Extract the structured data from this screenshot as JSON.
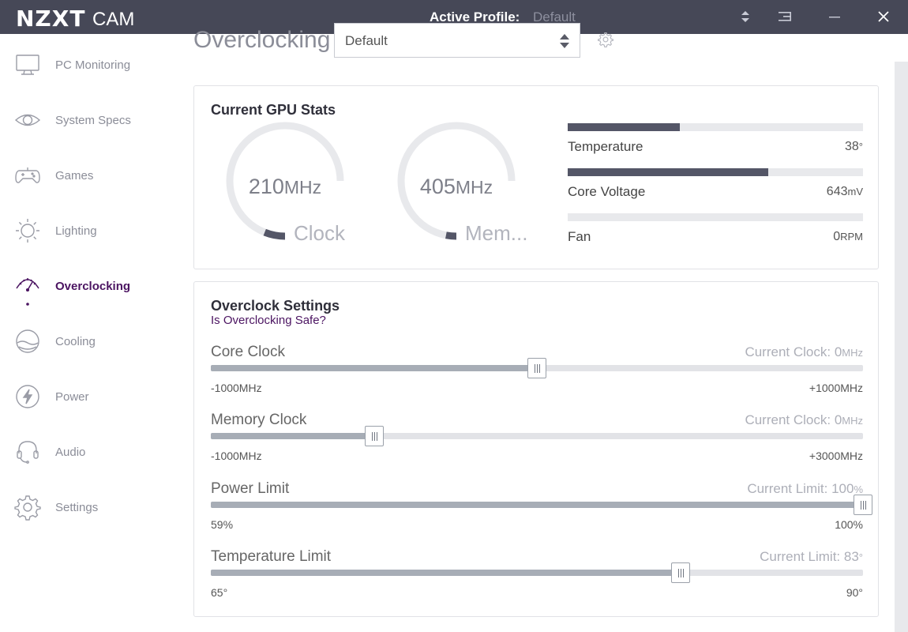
{
  "titlebar": {
    "logo": "NZXT",
    "logo_sub": "CAM",
    "active_profile_label": "Active Profile:",
    "active_profile_value": "Default"
  },
  "sidebar": {
    "items": [
      {
        "label": "PC Monitoring",
        "icon": "monitor-icon"
      },
      {
        "label": "System Specs",
        "icon": "eye-icon"
      },
      {
        "label": "Games",
        "icon": "gamepad-icon"
      },
      {
        "label": "Lighting",
        "icon": "sun-icon"
      },
      {
        "label": "Overclocking",
        "icon": "speedometer-icon",
        "active": true
      },
      {
        "label": "Cooling",
        "icon": "cooling-icon"
      },
      {
        "label": "Power",
        "icon": "lightning-icon"
      },
      {
        "label": "Audio",
        "icon": "headset-icon"
      },
      {
        "label": "Settings",
        "icon": "gear-icon"
      }
    ]
  },
  "header": {
    "title": "Overclocking",
    "profile_select_value": "Default"
  },
  "gpu_stats": {
    "title": "Current GPU Stats",
    "gauges": [
      {
        "value": "210",
        "unit": "MHz",
        "label": "Clock",
        "fraction": 0.08
      },
      {
        "value": "405",
        "unit": "MHz",
        "label": "Mem...",
        "fraction": 0.04
      }
    ],
    "bars": [
      {
        "name": "Temperature",
        "value": "38",
        "unit": "°",
        "fraction": 0.38
      },
      {
        "name": "Core Voltage",
        "value": "643",
        "unit": "mV",
        "fraction": 0.68
      },
      {
        "name": "Fan",
        "value": "0",
        "unit": "RPM",
        "fraction": 0
      }
    ]
  },
  "overclock": {
    "title": "Overclock Settings",
    "safe_link": "Is Overclocking Safe?",
    "sliders": [
      {
        "name": "Core Clock",
        "current_prefix": "Current Clock: ",
        "current_value": "0",
        "current_unit": "MHz",
        "min": "-1000MHz",
        "max": "+1000MHz",
        "fraction": 0.5
      },
      {
        "name": "Memory Clock",
        "current_prefix": "Current Clock: ",
        "current_value": "0",
        "current_unit": "MHz",
        "min": "-1000MHz",
        "max": "+3000MHz",
        "fraction": 0.25
      },
      {
        "name": "Power Limit",
        "current_prefix": "Current Limit: ",
        "current_value": "100",
        "current_unit": "%",
        "min": "59%",
        "max": "100%",
        "fraction": 1.0
      },
      {
        "name": "Temperature Limit",
        "current_prefix": "Current Limit: ",
        "current_value": "83",
        "current_unit": "°",
        "min": "65°",
        "max": "90°",
        "fraction": 0.72
      }
    ]
  },
  "colors": {
    "titlebar_bg": "#464857",
    "accent_purple": "#4b1461",
    "gauge_track": "#e8e9ec",
    "gauge_fill": "#545667",
    "stat_fill": "#545667",
    "slider_fill": "#a7adb6"
  }
}
